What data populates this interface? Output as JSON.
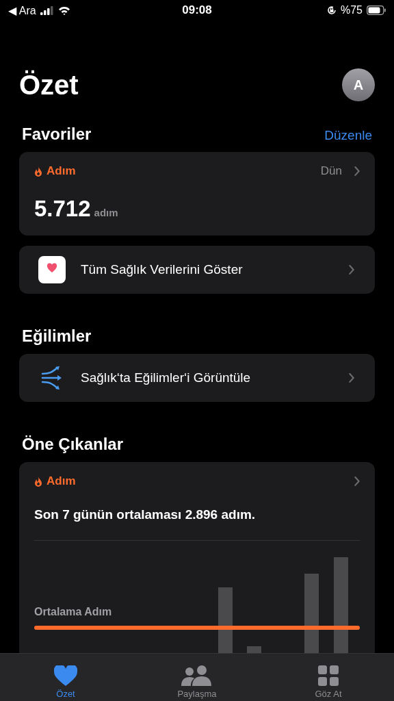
{
  "status_bar": {
    "back": "◀ Ara",
    "time": "09:08",
    "battery": "%75"
  },
  "title": "Özet",
  "avatar": "A",
  "favorites": {
    "title": "Favoriler",
    "action": "Düzenle",
    "metric": {
      "label": "Adım",
      "when": "Dün",
      "value": "5.712",
      "unit": "adım"
    },
    "all_data": "Tüm Sağlık Verilerini Göster"
  },
  "trends": {
    "title": "Eğilimler",
    "link": "Sağlık‘ta Eğilimler‘i Görüntüle"
  },
  "highlights": {
    "title": "Öne Çıkanlar",
    "label": "Adım",
    "sentence": "Son 7 günün ortalaması 2.896 adım.",
    "chart_label": "Ortalama Adım"
  },
  "tabs": [
    {
      "label": "Özet",
      "selected": true,
      "kind": "heart"
    },
    {
      "label": "Paylaşma",
      "selected": false,
      "kind": "people"
    },
    {
      "label": "Göz At",
      "selected": false,
      "kind": "grid"
    }
  ]
}
